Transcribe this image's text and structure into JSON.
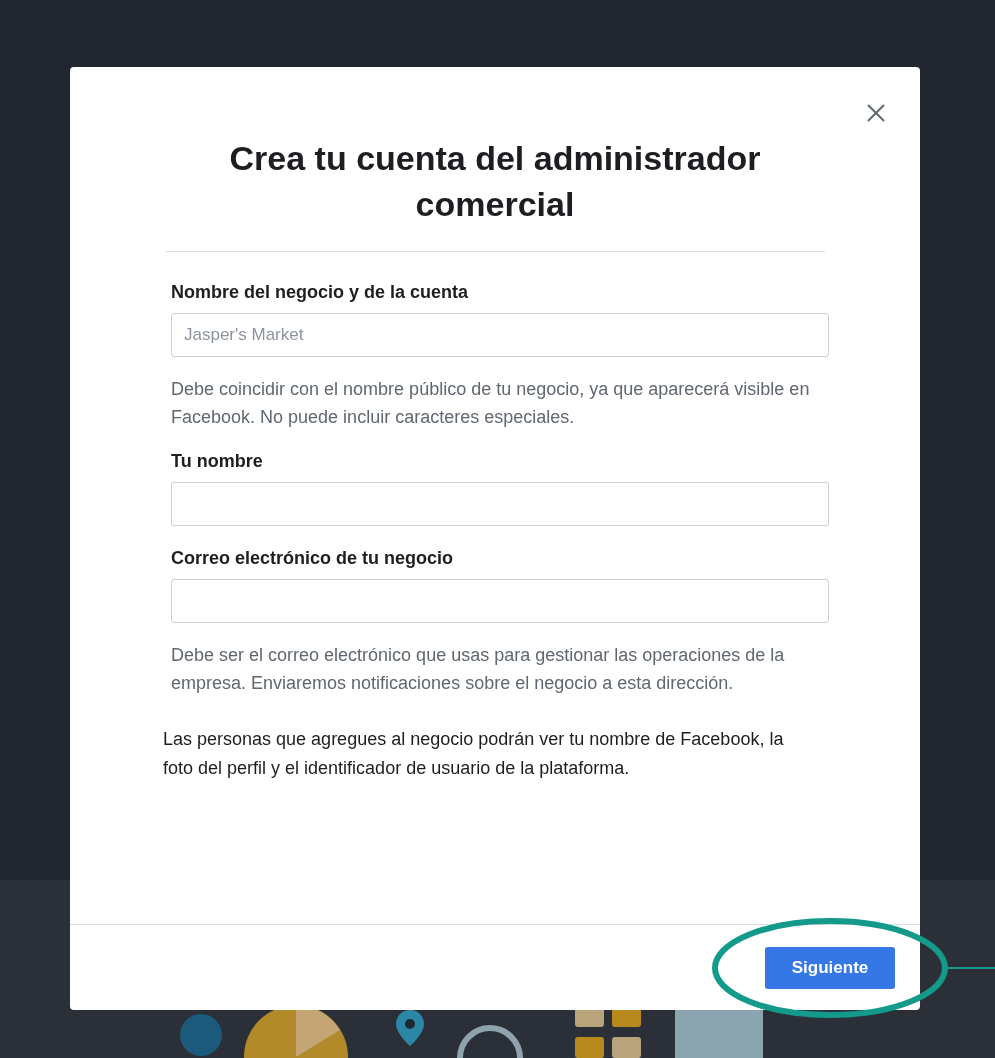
{
  "dialog": {
    "title": "Crea tu cuenta del administrador comercial",
    "fields": [
      {
        "label": "Nombre del negocio y de la cuenta",
        "placeholder": "Jasper's Market",
        "help": "Debe coincidir con el nombre público de tu negocio, ya que aparecerá visible en Facebook. No puede incluir caracteres especiales."
      },
      {
        "label": "Tu nombre"
      },
      {
        "label": "Correo electrónico de tu negocio",
        "help": "Debe ser el correo electrónico que usas para gestionar las operaciones de la empresa. Enviaremos notificaciones sobre el negocio a esta dirección."
      }
    ],
    "notice": "Las personas que agregues al negocio podrán ver tu nombre de Facebook, la foto del perfil y el identificador de usuario de la plataforma.",
    "primary_button": "Siguiente"
  }
}
